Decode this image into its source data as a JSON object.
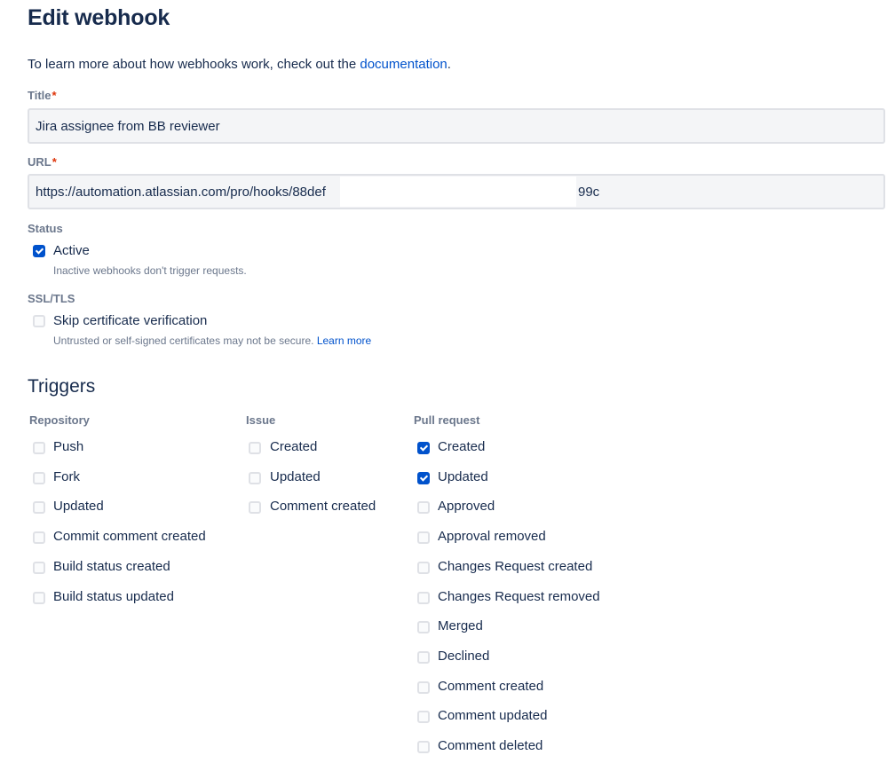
{
  "page": {
    "title": "Edit webhook",
    "intro_text": "To learn more about how webhooks work, check out the ",
    "intro_link": "documentation",
    "intro_end": "."
  },
  "form": {
    "title_label": "Title",
    "title_value": "Jira assignee from BB reviewer",
    "url_label": "URL",
    "url_value": "https://automation.atlassian.com/pro/hooks/88def",
    "url_suffix": "99c",
    "required_mark": "*",
    "status_label": "Status",
    "active_label": "Active",
    "active_checked": true,
    "active_help": "Inactive webhooks don't trigger requests.",
    "ssl_label": "SSL/TLS",
    "skip_label": "Skip certificate verification",
    "skip_checked": false,
    "skip_help": "Untrusted or self-signed certificates may not be secure. ",
    "skip_help_link": "Learn more"
  },
  "triggers": {
    "heading": "Triggers",
    "repository": {
      "heading": "Repository",
      "items": [
        {
          "label": "Push",
          "checked": false
        },
        {
          "label": "Fork",
          "checked": false
        },
        {
          "label": "Updated",
          "checked": false
        },
        {
          "label": "Commit comment created",
          "checked": false
        },
        {
          "label": "Build status created",
          "checked": false
        },
        {
          "label": "Build status updated",
          "checked": false
        }
      ]
    },
    "issue": {
      "heading": "Issue",
      "items": [
        {
          "label": "Created",
          "checked": false
        },
        {
          "label": "Updated",
          "checked": false
        },
        {
          "label": "Comment created",
          "checked": false
        }
      ]
    },
    "pull_request": {
      "heading": "Pull request",
      "items": [
        {
          "label": "Created",
          "checked": true
        },
        {
          "label": "Updated",
          "checked": true
        },
        {
          "label": "Approved",
          "checked": false
        },
        {
          "label": "Approval removed",
          "checked": false
        },
        {
          "label": "Changes Request created",
          "checked": false
        },
        {
          "label": "Changes Request removed",
          "checked": false
        },
        {
          "label": "Merged",
          "checked": false
        },
        {
          "label": "Declined",
          "checked": false
        },
        {
          "label": "Comment created",
          "checked": false
        },
        {
          "label": "Comment updated",
          "checked": false
        },
        {
          "label": "Comment deleted",
          "checked": false
        }
      ]
    }
  },
  "colors": {
    "accent": "#0052cc",
    "text": "#172b4d",
    "subtle_text": "#6b778c",
    "required": "#de350b"
  }
}
